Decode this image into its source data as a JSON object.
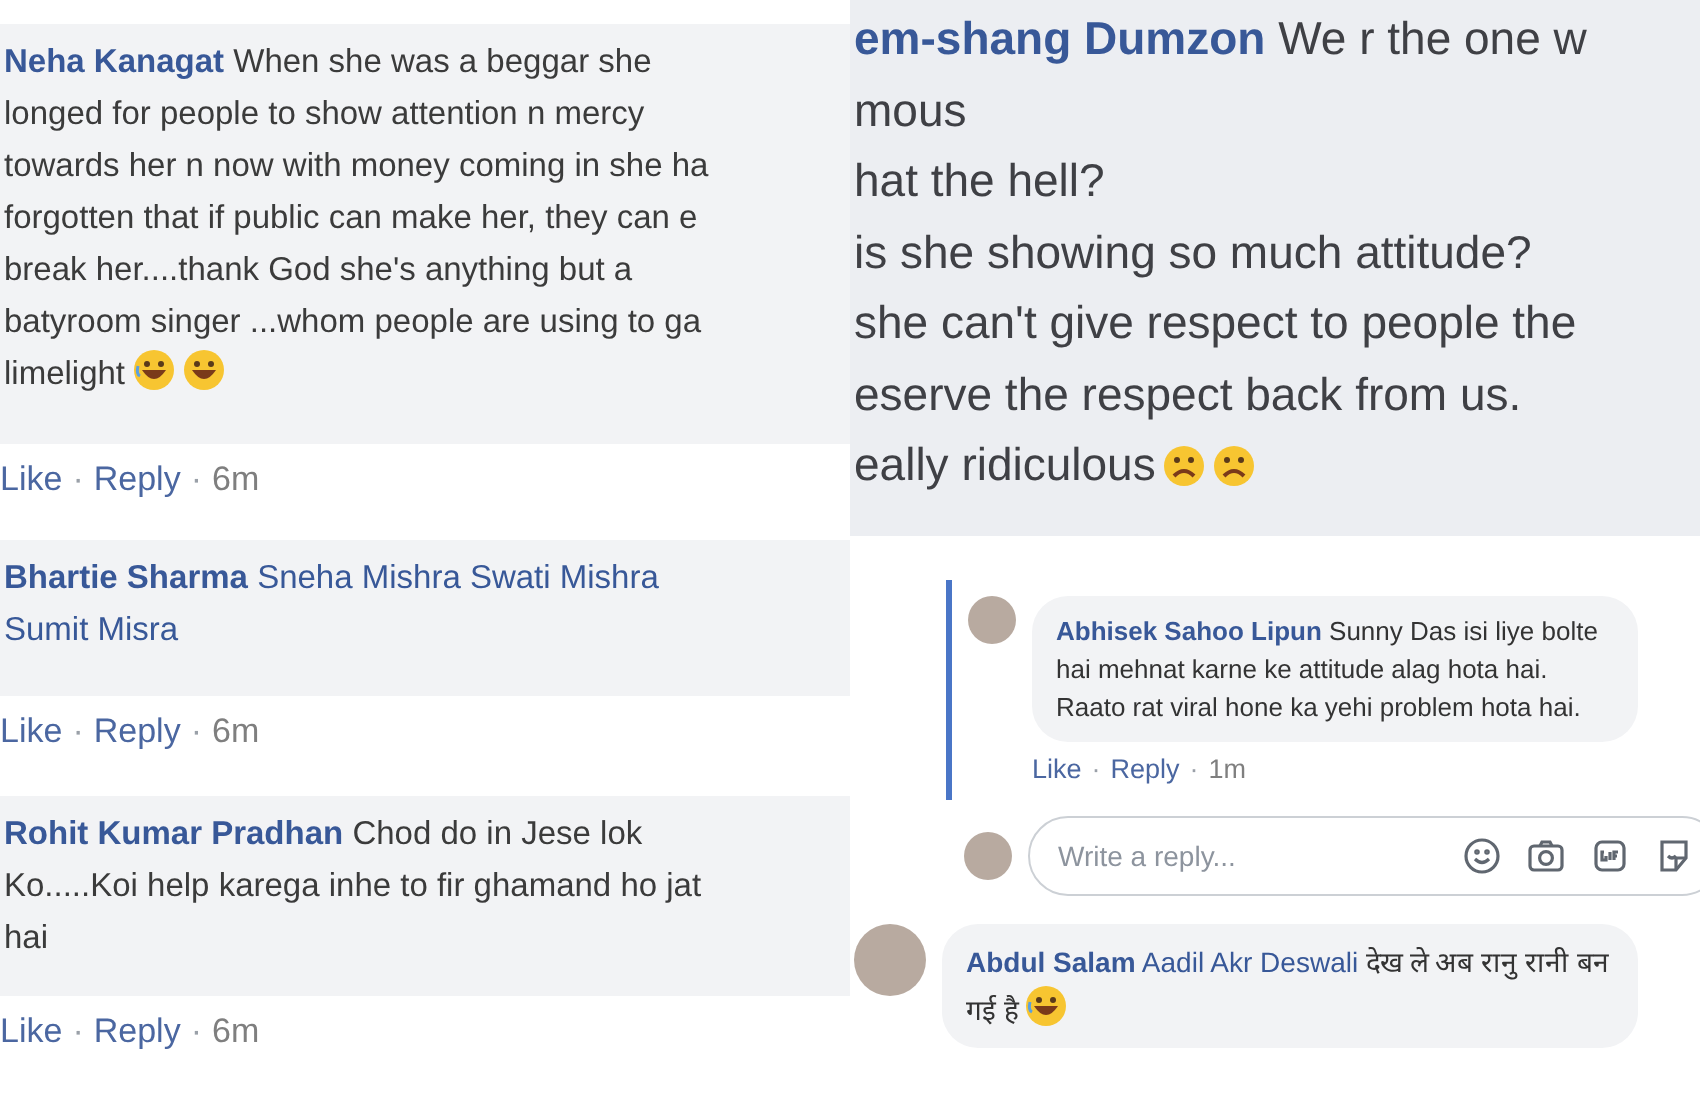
{
  "left_comments": [
    {
      "author": "Neha Kanagat",
      "lines": [
        "When she was a beggar she",
        "longed for people to show attention n mercy",
        "towards her n now with money coming in she ha",
        "forgotten that if public can make her, they can e",
        "break her....thank God she's anything but a",
        "batyroom singer ...whom people are using to ga",
        "limelight"
      ],
      "emoji": [
        {
          "kind": "laughing"
        },
        {
          "kind": "grinning"
        }
      ],
      "actions": [
        "Like",
        "Reply",
        "6m"
      ]
    },
    {
      "author": "Bhartie Sharma",
      "mention_lines": [
        "Sneha Mishra Swati Mishra",
        "Sumit Misra"
      ],
      "actions": [
        "Like",
        "Reply",
        "6m"
      ]
    },
    {
      "author": "Rohit Kumar Pradhan",
      "lines": [
        "Chod do in Jese lok",
        "Ko.....Koi help karega inhe to fir ghamand ho jat",
        "hai"
      ],
      "actions": [
        "Like",
        "Reply",
        "6m"
      ]
    }
  ],
  "separator": "·",
  "zoomed_comment": {
    "author": "em-shang Dumzon",
    "lines": [
      "We r the one w",
      "mous",
      "hat the hell?",
      "is she showing so much attitude?",
      "she can't give respect to people the",
      "eserve the respect back from us.",
      "eally ridiculous"
    ],
    "emoji": [
      {
        "kind": "frowning"
      },
      {
        "kind": "frowning"
      }
    ]
  },
  "reply": {
    "author": "Abhisek Sahoo Lipun",
    "text": "Sunny Das isi liye bolte hai mehnat karne ke attitude alag hota hai. Raato rat viral hone ka yehi problem hota hai.",
    "actions": [
      "Like",
      "Reply",
      "1m"
    ]
  },
  "reply_field": {
    "placeholder": "Write a reply..."
  },
  "last_comment": {
    "author": "Abdul Salam",
    "mention": "Aadil Akr Deswali",
    "text": "देख ले अब रानु रानी बन गई है",
    "emoji": [
      {
        "kind": "laughing"
      }
    ]
  }
}
